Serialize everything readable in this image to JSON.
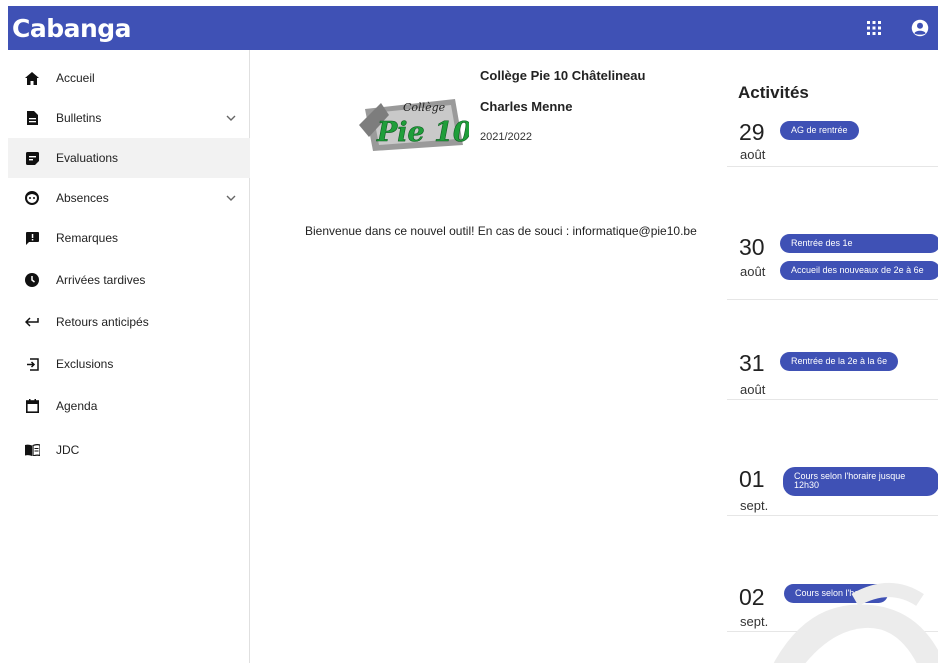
{
  "app": {
    "brand": "Cabanga"
  },
  "sidebar": {
    "items": [
      {
        "label": "Accueil",
        "icon": "home-icon"
      },
      {
        "label": "Bulletins",
        "icon": "file-icon",
        "expandable": true
      },
      {
        "label": "Evaluations",
        "icon": "note-icon",
        "active": true
      },
      {
        "label": "Absences",
        "icon": "face-icon",
        "expandable": true
      },
      {
        "label": "Remarques",
        "icon": "feedback-icon"
      },
      {
        "label": "Arrivées tardives",
        "icon": "clock-icon"
      },
      {
        "label": "Retours anticipés",
        "icon": "back-arrow-icon"
      },
      {
        "label": "Exclusions",
        "icon": "exit-icon"
      },
      {
        "label": "Agenda",
        "icon": "calendar-icon"
      },
      {
        "label": "JDC",
        "icon": "book-icon"
      }
    ]
  },
  "main": {
    "school": "Collège Pie 10 Châtelineau",
    "person": "Charles Menne",
    "year": "2021/2022",
    "logo_text_top": "Collège",
    "logo_text_main": "Pie 10",
    "welcome": "Bienvenue dans ce nouvel outil! En cas de souci : informatique@pie10.be"
  },
  "activities": {
    "title": "Activités",
    "days": [
      {
        "day": "29",
        "month": "août",
        "events": [
          "AG de rentrée"
        ]
      },
      {
        "day": "30",
        "month": "août",
        "events": [
          "Rentrée des 1e",
          "Accueil des nouveaux de 2e à 6e"
        ]
      },
      {
        "day": "31",
        "month": "août",
        "events": [
          "Rentrée de la 2e à la 6e"
        ]
      },
      {
        "day": "01",
        "month": "sept.",
        "events": [
          "Cours selon l'horaire jusque 12h30"
        ]
      },
      {
        "day": "02",
        "month": "sept.",
        "events": [
          "Cours selon l'horaire"
        ]
      }
    ]
  },
  "colors": {
    "primary": "#3f51b5",
    "active_bg": "#f2f2f2"
  }
}
